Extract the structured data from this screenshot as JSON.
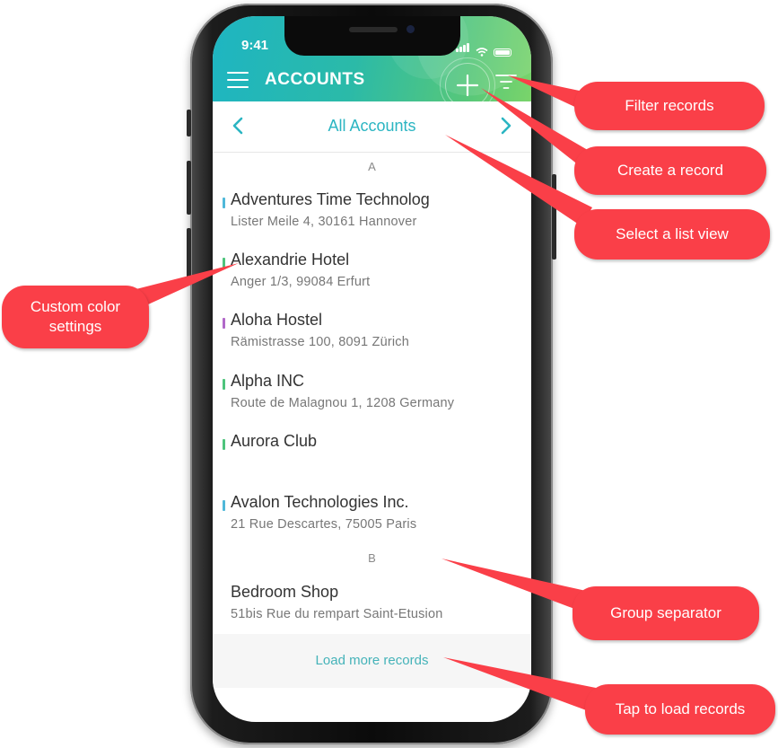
{
  "status": {
    "time": "9:41"
  },
  "header": {
    "title": "ACCOUNTS"
  },
  "icons": {
    "menu": "hamburger-icon",
    "add": "plus-icon",
    "filter": "filter-icon",
    "prev": "chevron-left-icon",
    "next": "chevron-right-icon"
  },
  "list_view": {
    "label": "All Accounts"
  },
  "groups": [
    {
      "letter": "A",
      "records": [
        {
          "name": "Adventures Time Technolog",
          "address": "Lister Meile 4, 30161 Hannover",
          "color": "#4fb8d9"
        },
        {
          "name": "Alexandrie Hotel",
          "address": "Anger 1/3, 99084 Erfurt",
          "color": "#4ec47c"
        },
        {
          "name": "Aloha Hostel",
          "address": "Rämistrasse 100, 8091 Zürich",
          "color": "#b169c9"
        },
        {
          "name": "Alpha INC",
          "address": "Route de Malagnou 1, 1208 Germany",
          "color": "#4ec47c"
        },
        {
          "name": "Aurora Club",
          "address": "",
          "color": "#4ec47c"
        },
        {
          "name": "Avalon Technologies Inc.",
          "address": "21 Rue Descartes, 75005 Paris",
          "color": "#4fb8d9"
        }
      ]
    },
    {
      "letter": "B",
      "records": [
        {
          "name": "Bedroom Shop",
          "address": "51bis Rue du rempart Saint-Etusion",
          "color": ""
        }
      ]
    }
  ],
  "load_more": {
    "label": "Load more records"
  },
  "callouts": {
    "filter": "Filter records",
    "create": "Create a record",
    "list_view": "Select a list view",
    "custom_color": "Custom color settings",
    "group_separator": "Group separator",
    "load_records": "Tap to load records"
  },
  "colors": {
    "callout": "#fa3f48",
    "accent": "#2bb5c2"
  }
}
